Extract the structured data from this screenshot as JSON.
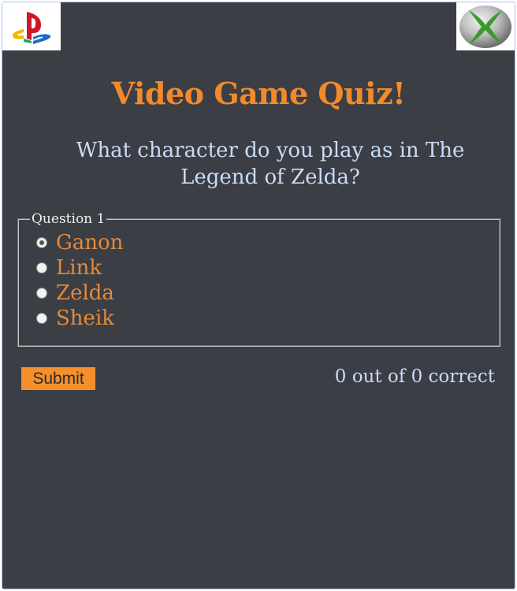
{
  "header": {
    "left_logo_icon": "playstation-logo-icon",
    "right_logo_icon": "xbox-logo-icon"
  },
  "quiz": {
    "title": "Video Game Quiz!",
    "question": "What character do you play as in The Legend of Zelda?",
    "fieldset_legend": "Question 1",
    "options": [
      {
        "label": "Ganon",
        "checked": true
      },
      {
        "label": "Link",
        "checked": false
      },
      {
        "label": "Zelda",
        "checked": false
      },
      {
        "label": "Sheik",
        "checked": false
      }
    ],
    "submit_label": "Submit",
    "score_text": "0 out of 0 correct"
  },
  "colors": {
    "background": "#3b3e44",
    "accent_orange": "#f28a2c",
    "question_blue": "#c9dcf7"
  }
}
